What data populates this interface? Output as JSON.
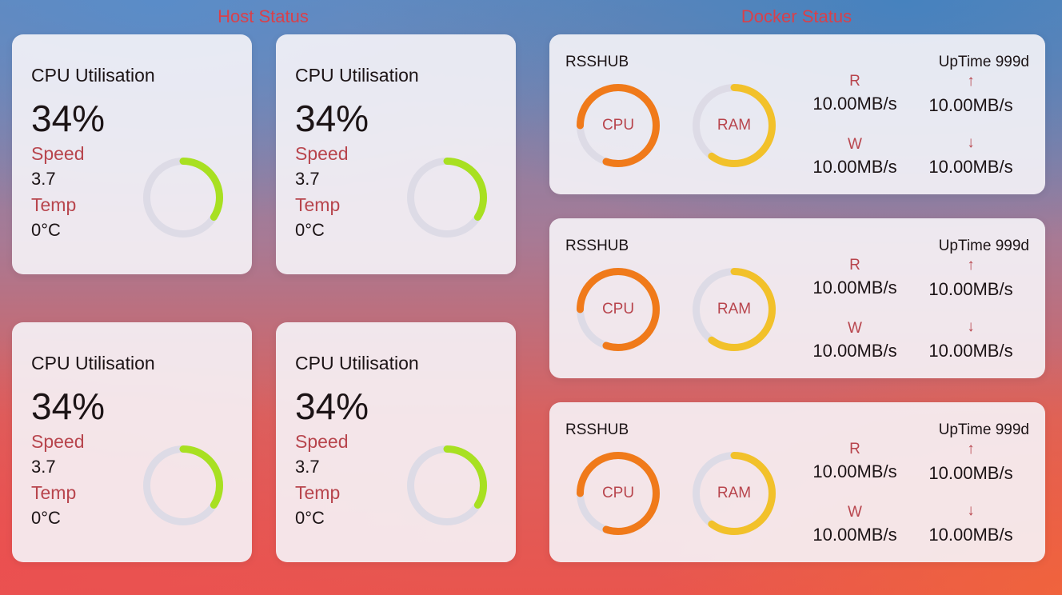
{
  "sections": {
    "host_title": "Host Status",
    "docker_title": "Docker Status"
  },
  "colors": {
    "title": "#d9404a",
    "label": "#b8454d",
    "host_ring": "#a8e021",
    "ring_track": "#dddbe6",
    "cpu_ring": "#f07a1a",
    "ram_ring": "#f2c12a"
  },
  "host_cards": [
    {
      "title": "CPU Utilisation",
      "value": "34%",
      "speed_label": "Speed",
      "speed": "3.7",
      "temp_label": "Temp",
      "temp": "0°C",
      "ring_fraction": 0.34
    },
    {
      "title": "CPU Utilisation",
      "value": "34%",
      "speed_label": "Speed",
      "speed": "3.7",
      "temp_label": "Temp",
      "temp": "0°C",
      "ring_fraction": 0.34
    },
    {
      "title": "CPU Utilisation",
      "value": "34%",
      "speed_label": "Speed",
      "speed": "3.7",
      "temp_label": "Temp",
      "temp": "0°C",
      "ring_fraction": 0.34
    },
    {
      "title": "CPU Utilisation",
      "value": "34%",
      "speed_label": "Speed",
      "speed": "3.7",
      "temp_label": "Temp",
      "temp": "0°C",
      "ring_fraction": 0.34
    }
  ],
  "docker_cards": [
    {
      "name": "RSSHUB",
      "uptime": "UpTime 999d",
      "cpu_label": "CPU",
      "ram_label": "RAM",
      "cpu_fraction": 0.8,
      "ram_fraction": 0.6,
      "read_label": "R",
      "read": "10.00MB/s",
      "write_label": "W",
      "write": "10.00MB/s",
      "up_icon": "↑",
      "up": "10.00MB/s",
      "down_icon": "↓",
      "down": "10.00MB/s"
    },
    {
      "name": "RSSHUB",
      "uptime": "UpTime 999d",
      "cpu_label": "CPU",
      "ram_label": "RAM",
      "cpu_fraction": 0.8,
      "ram_fraction": 0.6,
      "read_label": "R",
      "read": "10.00MB/s",
      "write_label": "W",
      "write": "10.00MB/s",
      "up_icon": "↑",
      "up": "10.00MB/s",
      "down_icon": "↓",
      "down": "10.00MB/s"
    },
    {
      "name": "RSSHUB",
      "uptime": "UpTime 999d",
      "cpu_label": "CPU",
      "ram_label": "RAM",
      "cpu_fraction": 0.8,
      "ram_fraction": 0.6,
      "read_label": "R",
      "read": "10.00MB/s",
      "write_label": "W",
      "write": "10.00MB/s",
      "up_icon": "↑",
      "up": "10.00MB/s",
      "down_icon": "↓",
      "down": "10.00MB/s"
    }
  ]
}
